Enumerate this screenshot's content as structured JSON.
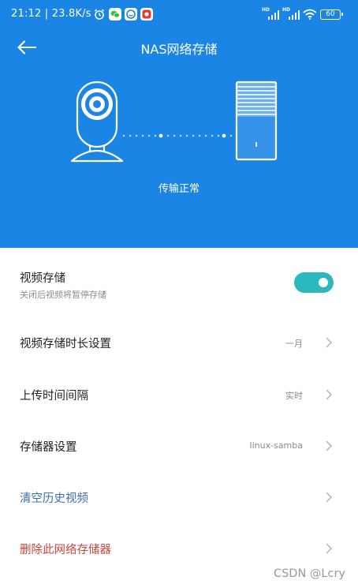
{
  "status_bar": {
    "time_speed": "21:12 | 23.8K/s",
    "network_label": "HD",
    "battery": "60"
  },
  "header": {
    "title": "NAS网络存储"
  },
  "illustration": {
    "status": "传输正常"
  },
  "settings": {
    "video_storage": {
      "label": "视频存储",
      "subtitle": "关闭后视频将暂停存储",
      "enabled": true
    },
    "storage_duration": {
      "label": "视频存储时长设置",
      "value": "一月"
    },
    "upload_interval": {
      "label": "上传时间间隔",
      "value": "实时"
    },
    "storage_device": {
      "label": "存储器设置",
      "value": "linux-samba"
    },
    "clear_history": {
      "label": "清空历史视频"
    },
    "delete_storage": {
      "label": "删除此网络存储器"
    }
  },
  "watermark": "CSDN @Lcry",
  "colors": {
    "header_blue": "#1b85e6",
    "toggle_teal": "#2bb8bf",
    "action_blue": "#3b6fb2",
    "danger_red": "#c9463c",
    "chevron_gray": "#b5b5b5"
  }
}
